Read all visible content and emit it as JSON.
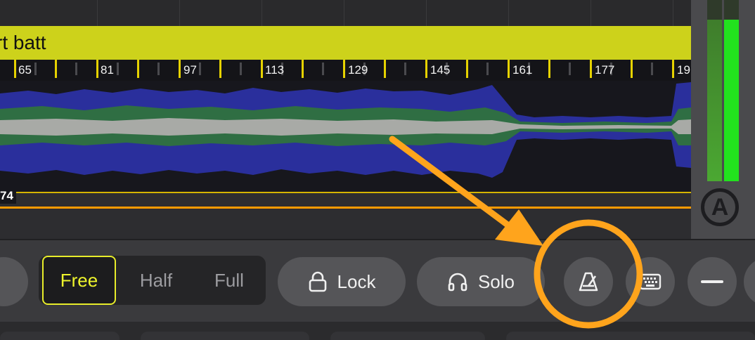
{
  "clip": {
    "title": "rt batt",
    "color": "#cdd21b"
  },
  "ruler": {
    "labels": [
      "65",
      "81",
      "97",
      "113",
      "129",
      "145",
      "161",
      "177",
      "19"
    ]
  },
  "timeline": {
    "time_tag": "74"
  },
  "toolbar": {
    "modes": [
      {
        "label": "Free",
        "active": true
      },
      {
        "label": "Half",
        "active": false
      },
      {
        "label": "Full",
        "active": false
      }
    ],
    "lock_label": "Lock",
    "solo_label": "Solo"
  },
  "meter": {
    "logo_letter": "A",
    "left_level": 0.89,
    "right_level": 0.89
  },
  "colors": {
    "accent": "#eef42c",
    "annotation": "#ffa41c",
    "meter_green": "#22e21e"
  },
  "icons": [
    "lock-icon",
    "headphones-icon",
    "metronome-icon",
    "keyboard-icon",
    "minus-icon"
  ]
}
